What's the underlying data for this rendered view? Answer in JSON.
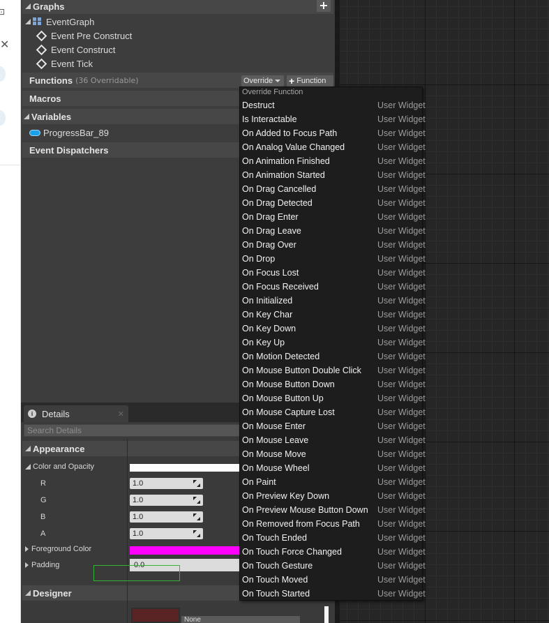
{
  "blueprint": {
    "graphs_label": "Graphs",
    "event_graph_label": "EventGraph",
    "events": [
      "Event Pre Construct",
      "Event Construct",
      "Event Tick"
    ],
    "functions_label": "Functions",
    "functions_overridable": "(36 Overridable)",
    "override_button": "Override",
    "add_function_button": "Function",
    "macros_label": "Macros",
    "variables_label": "Variables",
    "variable_item": "ProgressBar_89",
    "event_dispatchers_label": "Event Dispatchers"
  },
  "details": {
    "tab_label": "Details",
    "search_placeholder": "Search Details",
    "appearance_label": "Appearance",
    "color_opacity_label": "Color and Opacity",
    "channels": [
      {
        "label": "R",
        "value": "1.0"
      },
      {
        "label": "G",
        "value": "1.0"
      },
      {
        "label": "B",
        "value": "1.0"
      },
      {
        "label": "A",
        "value": "1.0"
      }
    ],
    "foreground_color_label": "Foreground Color",
    "padding_label": "Padding",
    "padding_value": "0.0",
    "designer_label": "Designer",
    "brush_combo_value": "None",
    "color_and_opacity_swatch": "#ffffff",
    "foreground_color_swatch": "#ff00ff"
  },
  "override_menu": {
    "header": "Override Function",
    "items": [
      {
        "name": "Destruct",
        "category": "User Widget"
      },
      {
        "name": "Is Interactable",
        "category": "User Widget"
      },
      {
        "name": "On Added to Focus Path",
        "category": "User Widget"
      },
      {
        "name": "On Analog Value Changed",
        "category": "User Widget"
      },
      {
        "name": "On Animation Finished",
        "category": "User Widget"
      },
      {
        "name": "On Animation Started",
        "category": "User Widget"
      },
      {
        "name": "On Drag Cancelled",
        "category": "User Widget"
      },
      {
        "name": "On Drag Detected",
        "category": "User Widget"
      },
      {
        "name": "On Drag Enter",
        "category": "User Widget"
      },
      {
        "name": "On Drag Leave",
        "category": "User Widget"
      },
      {
        "name": "On Drag Over",
        "category": "User Widget"
      },
      {
        "name": "On Drop",
        "category": "User Widget"
      },
      {
        "name": "On Focus Lost",
        "category": "User Widget"
      },
      {
        "name": "On Focus Received",
        "category": "User Widget"
      },
      {
        "name": "On Initialized",
        "category": "User Widget"
      },
      {
        "name": "On Key Char",
        "category": "User Widget"
      },
      {
        "name": "On Key Down",
        "category": "User Widget"
      },
      {
        "name": "On Key Up",
        "category": "User Widget"
      },
      {
        "name": "On Motion Detected",
        "category": "User Widget"
      },
      {
        "name": "On Mouse Button Double Click",
        "category": "User Widget"
      },
      {
        "name": "On Mouse Button Down",
        "category": "User Widget"
      },
      {
        "name": "On Mouse Button Up",
        "category": "User Widget"
      },
      {
        "name": "On Mouse Capture Lost",
        "category": "User Widget"
      },
      {
        "name": "On Mouse Enter",
        "category": "User Widget"
      },
      {
        "name": "On Mouse Leave",
        "category": "User Widget"
      },
      {
        "name": "On Mouse Move",
        "category": "User Widget"
      },
      {
        "name": "On Mouse Wheel",
        "category": "User Widget"
      },
      {
        "name": "On Paint",
        "category": "User Widget"
      },
      {
        "name": "On Preview Key Down",
        "category": "User Widget"
      },
      {
        "name": "On Preview Mouse Button Down",
        "category": "User Widget"
      },
      {
        "name": "On Removed from Focus Path",
        "category": "User Widget"
      },
      {
        "name": "On Touch Ended",
        "category": "User Widget"
      },
      {
        "name": "On Touch Force Changed",
        "category": "User Widget"
      },
      {
        "name": "On Touch Gesture",
        "category": "User Widget"
      },
      {
        "name": "On Touch Moved",
        "category": "User Widget"
      },
      {
        "name": "On Touch Started",
        "category": "User Widget"
      }
    ]
  }
}
